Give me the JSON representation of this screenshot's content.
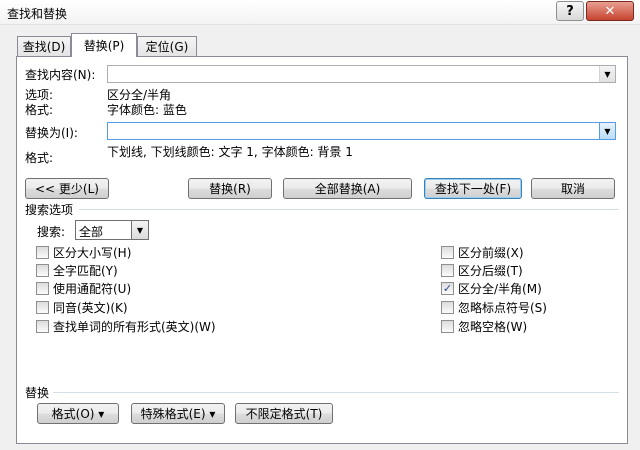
{
  "window": {
    "title": "查找和替换",
    "help": "?",
    "close": "✕"
  },
  "tabs": [
    {
      "label": "查找(D)"
    },
    {
      "label": "替换(P)"
    },
    {
      "label": "定位(G)"
    }
  ],
  "find": {
    "label": "查找内容(N):",
    "value": "",
    "options_label": "选项:",
    "options_value": "区分全/半角",
    "format_label": "格式:",
    "format_value": "字体颜色: 蓝色"
  },
  "replace": {
    "label": "替换为(I):",
    "value": "",
    "format_label": "格式:",
    "format_value": "下划线, 下划线颜色: 文字 1, 字体颜色: 背景 1"
  },
  "buttons": {
    "less": "<< 更少(L)",
    "replace": "替换(R)",
    "replace_all": "全部替换(A)",
    "find_next": "查找下一处(F)",
    "cancel": "取消"
  },
  "search_options": {
    "title": "搜索选项",
    "search_label": "搜索:",
    "search_value": "全部",
    "left": [
      {
        "label": "区分大小写(H)",
        "checked": false
      },
      {
        "label": "全字匹配(Y)",
        "checked": false
      },
      {
        "label": "使用通配符(U)",
        "checked": false
      },
      {
        "label": "同音(英文)(K)",
        "checked": false
      },
      {
        "label": "查找单词的所有形式(英文)(W)",
        "checked": false
      }
    ],
    "right": [
      {
        "label": "区分前缀(X)",
        "checked": false
      },
      {
        "label": "区分后缀(T)",
        "checked": false
      },
      {
        "label": "区分全/半角(M)",
        "checked": true
      },
      {
        "label": "忽略标点符号(S)",
        "checked": false
      },
      {
        "label": "忽略空格(W)",
        "checked": false
      }
    ]
  },
  "replace_section": {
    "title": "替换",
    "format_btn": "格式(O) ▾",
    "special_btn": "特殊格式(E) ▾",
    "no_format_btn": "不限定格式(T)"
  },
  "icons": {
    "check_glyph": "✓",
    "dropdown_glyph": "▼"
  }
}
